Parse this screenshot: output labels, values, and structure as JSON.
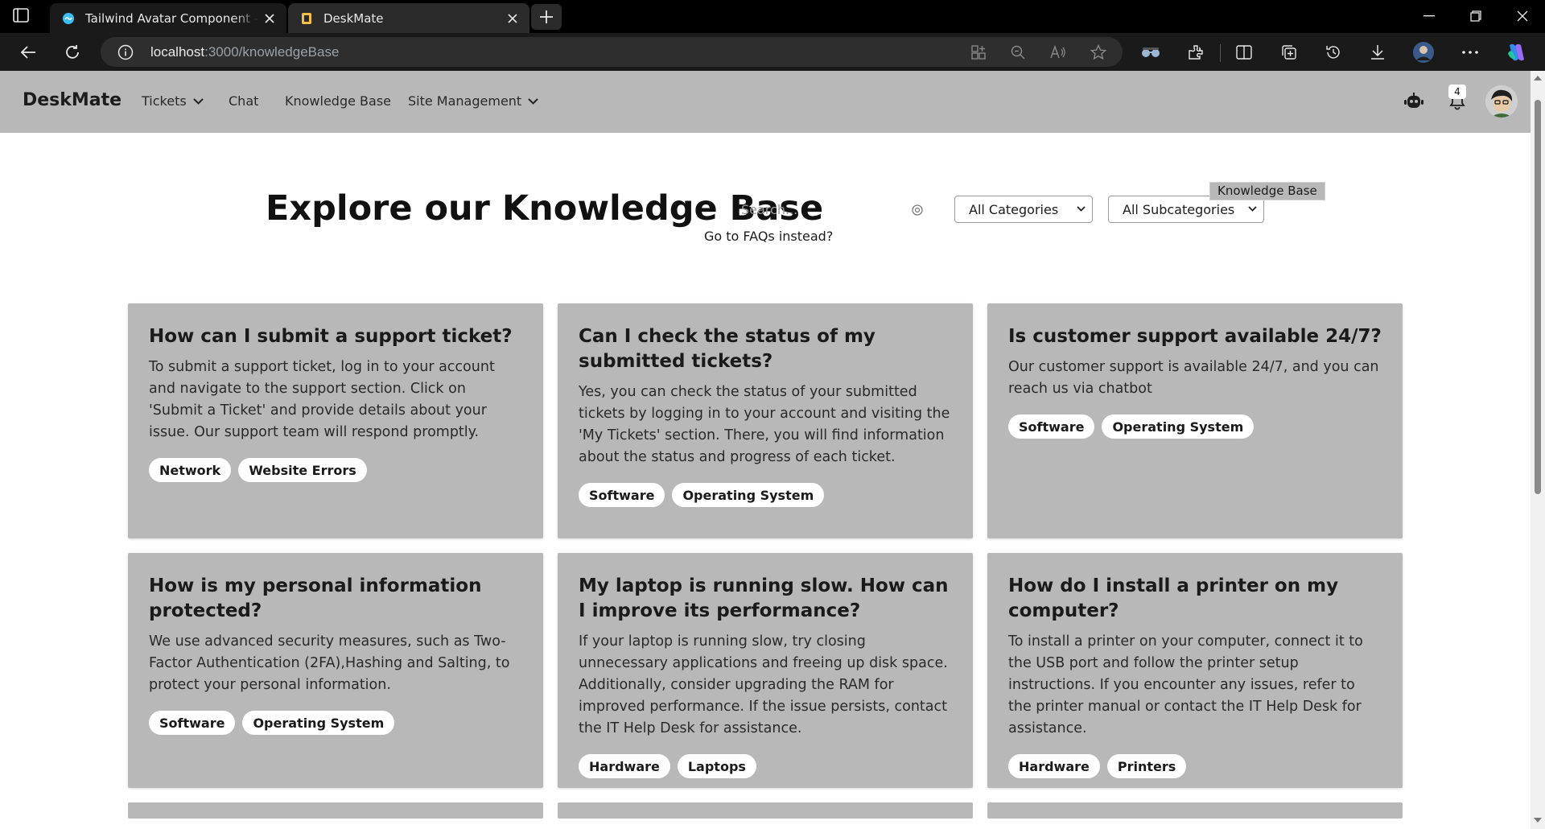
{
  "browser": {
    "tabs": [
      {
        "title": "Tailwind Avatar Component — Ta",
        "active": false
      },
      {
        "title": "DeskMate",
        "active": true
      }
    ],
    "address": {
      "host": "localhost",
      "path": ":3000/knowledgeBase"
    }
  },
  "app": {
    "brand": "DeskMate",
    "nav": {
      "tickets": "Tickets",
      "chat": "Chat",
      "knowledge_base": "Knowledge Base",
      "site_management": "Site Management"
    },
    "notifications_count": "4"
  },
  "hero": {
    "title": "Explore our Knowledge Base",
    "search_placeholder": "Search...",
    "faq_link": "Go to FAQs instead?",
    "category_select": "All Categories",
    "subcategory_select": "All Subcategories",
    "tooltip": "Knowledge Base"
  },
  "articles": [
    {
      "title": "How can I submit a support ticket?",
      "body": "To submit a support ticket, log in to your account and navigate to the support section. Click on 'Submit a Ticket' and provide details about your issue. Our support team will respond promptly.",
      "tags": [
        "Network",
        "Website Errors"
      ]
    },
    {
      "title": "Can I check the status of my submitted tickets?",
      "body": "Yes, you can check the status of your submitted tickets by logging in to your account and visiting the 'My Tickets' section. There, you will find information about the status and progress of each ticket.",
      "tags": [
        "Software",
        "Operating System"
      ]
    },
    {
      "title": "Is customer support available 24/7?",
      "body": "Our customer support is available 24/7, and you can reach us via chatbot",
      "tags": [
        "Software",
        "Operating System"
      ]
    },
    {
      "title": "How is my personal information protected?",
      "body": "We use advanced security measures, such as Two-Factor Authentication (2FA),Hashing and Salting, to protect your personal information.",
      "tags": [
        "Software",
        "Operating System"
      ]
    },
    {
      "title": "My laptop is running slow. How can I improve its performance?",
      "body": "If your laptop is running slow, try closing unnecessary applications and freeing up disk space. Additionally, consider upgrading the RAM for improved performance. If the issue persists, contact the IT Help Desk for assistance.",
      "tags": [
        "Hardware",
        "Laptops"
      ]
    },
    {
      "title": "How do I install a printer on my computer?",
      "body": "To install a printer on your computer, connect it to the USB port and follow the printer setup instructions. If you encounter any issues, refer to the printer manual or contact the IT Help Desk for assistance.",
      "tags": [
        "Hardware",
        "Printers"
      ]
    }
  ],
  "colors": {
    "nav_bg": "#b8b8b8",
    "card_bg": "#b8b8b8",
    "tag_bg": "#ffffff",
    "browser_chrome": "#000000"
  }
}
